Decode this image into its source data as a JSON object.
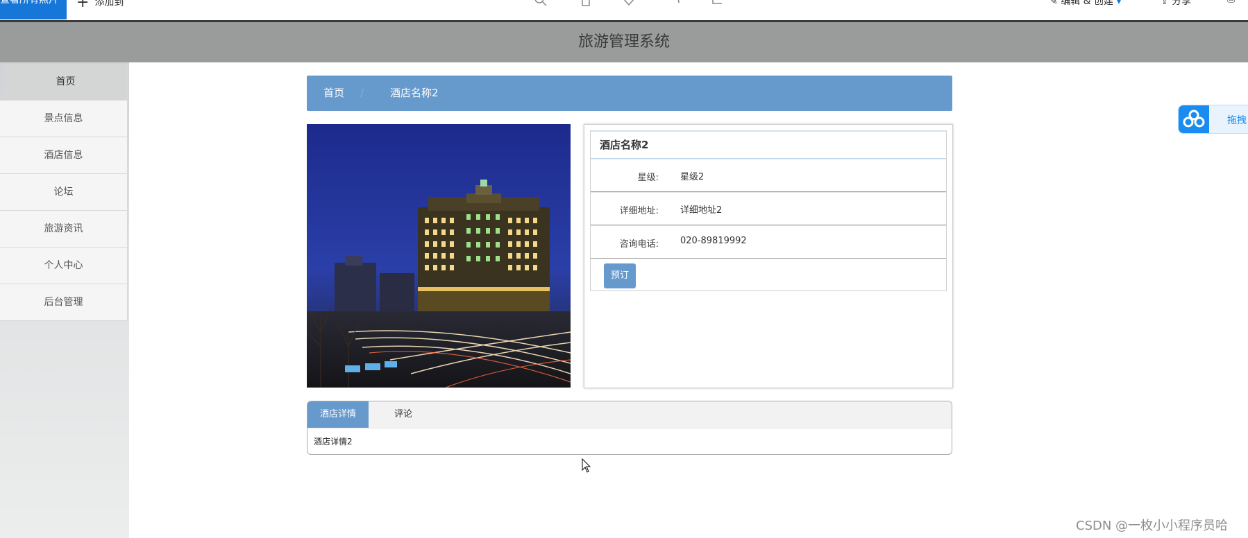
{
  "viewer_toolbar": {
    "view_all_label": "查看所有照片",
    "add_to_label": "添加到",
    "edit_create_label": "编辑 & 创建",
    "share_label": "分享"
  },
  "header": {
    "title": "旅游管理系统"
  },
  "sidebar": {
    "items": [
      {
        "label": "首页",
        "active": true
      },
      {
        "label": "景点信息"
      },
      {
        "label": "酒店信息"
      },
      {
        "label": "论坛"
      },
      {
        "label": "旅游资讯"
      },
      {
        "label": "个人中心"
      },
      {
        "label": "后台管理"
      }
    ]
  },
  "breadcrumb": {
    "home": "首页",
    "separator": "/",
    "current": "酒店名称2"
  },
  "hotel": {
    "name": "酒店名称2",
    "fields": [
      {
        "label": "星级:",
        "value": "星级2"
      },
      {
        "label": "详细地址:",
        "value": "详细地址2"
      },
      {
        "label": "咨询电话:",
        "value": "020-89819992"
      }
    ],
    "book_label": "预订"
  },
  "tabs": {
    "items": [
      {
        "label": "酒店详情",
        "active": true
      },
      {
        "label": "评论"
      }
    ],
    "content": "酒店详情2"
  },
  "drag_widget": {
    "label": "拖拽"
  },
  "watermark": "CSDN @一枚小小程序员哈",
  "colors": {
    "primary": "#6699cc",
    "header_bg": "#9a9c9b",
    "viewer_accent": "#1677d9",
    "drag_accent": "#1a8cf0"
  }
}
